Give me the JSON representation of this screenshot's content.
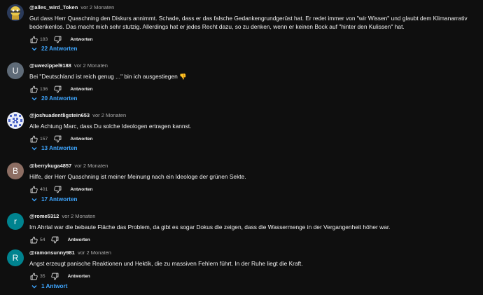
{
  "comments": [
    {
      "author": "@alles_wird_Token",
      "date": "vor 2 Monaten",
      "text": "Gut dass Herr Quaschning den Diskurs annimmt. Schade, dass er das falsche Gedankengrundgerüst hat. Er redet immer von \"wir Wissen\" und glaubt dem Klimanarrativ bedenkenlos. Das macht mich sehr stutzig. Allerdings hat er jedes Recht dazu, so zu denken, wenn er keinen Bock auf \"hinter den Kulissen\" hat.",
      "likes": "183",
      "reply_label": "Antworten",
      "replies_label": "22 Antworten",
      "avatar_letter": "",
      "avatar_color": "#c9b458"
    },
    {
      "author": "@uwezippel9188",
      "date": "vor 2 Monaten",
      "text": "Bei \"Deutschland ist reich genug ...\" bin ich ausgestiegen 👎",
      "likes": "136",
      "reply_label": "Antworten",
      "replies_label": "20 Antworten",
      "avatar_letter": "U",
      "avatar_color": "#5f6b78"
    },
    {
      "author": "@joshuadentligstein653",
      "date": "vor 2 Monaten",
      "text": "Alle Achtung Marc, dass Du solche Ideologen ertragen kannst.",
      "likes": "157",
      "reply_label": "Antworten",
      "replies_label": "13 Antworten",
      "avatar_letter": "",
      "avatar_color": "#e8ecf8"
    },
    {
      "author": "@berrykuga4857",
      "date": "vor 2 Monaten",
      "text": "Hilfe, der Herr Quaschning ist meiner Meinung nach ein Ideologe der grünen Sekte.",
      "likes": "401",
      "reply_label": "Antworten",
      "replies_label": "17 Antworten",
      "avatar_letter": "B",
      "avatar_color": "#8d6e63"
    },
    {
      "author": "@rome5312",
      "date": "vor 2 Monaten",
      "text": "Im Ahrtal war die bebaute Fläche das Problem, da gibt es sogar Dokus die zeigen, dass die Wassermenge in der Vergangenheit höher war.",
      "likes": "54",
      "reply_label": "Antworten",
      "replies_label": "",
      "avatar_letter": "r",
      "avatar_color": "#00838f"
    },
    {
      "author": "@ramonsunny981",
      "date": "vor 2 Monaten",
      "text": "Angst erzeugt panische Reaktionen und Hektik, die zu massiven Fehlern führt. In der Ruhe liegt die Kraft.",
      "likes": "35",
      "reply_label": "Antworten",
      "replies_label": "1 Antwort",
      "avatar_letter": "R",
      "avatar_color": "#00838f"
    }
  ],
  "colors": {
    "background": "#0f0f0f",
    "link": "#3ea6ff",
    "muted": "#aaaaaa",
    "text": "#f1f1f1"
  },
  "icons": {
    "like": "thumbs-up-icon",
    "dislike": "thumbs-down-icon",
    "expand": "chevron-down-icon"
  }
}
